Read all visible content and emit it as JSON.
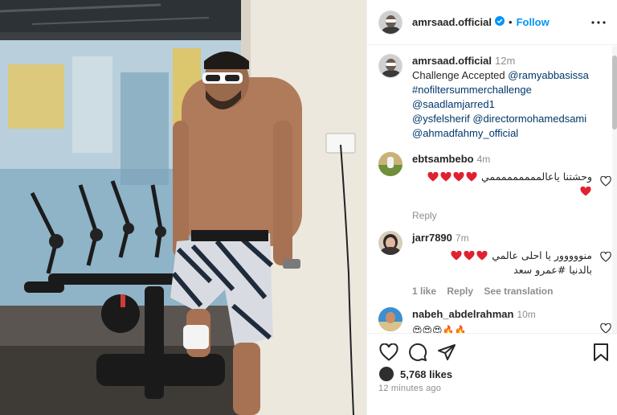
{
  "post": {
    "username": "amrsaad.official",
    "follow_label": "Follow",
    "caption": {
      "username": "amrsaad.official",
      "time": "12m",
      "intro": "Challenge Accepted",
      "first_mention": "@ramyabbasissa",
      "mentions": [
        "#nofiltersummerchallenge",
        "@saadlamjarred1",
        "@ysfelsherif"
      ],
      "inline_mention": "@directormohamedsami",
      "last_mention": "@ahmadfahmy_official"
    },
    "comments": [
      {
        "username": "ebtsambebo",
        "time": "4m",
        "text": "وحشتنا ياعالمممممممممي",
        "hearts": 5,
        "actions": [
          "Reply"
        ]
      },
      {
        "username": "jarr7890",
        "time": "7m",
        "text_line1": "منووووور يا احلى عالمي",
        "text_line2": "بالدنيا #عمرو سعد",
        "hearts": 3,
        "actions": [
          "1 like",
          "Reply",
          "See translation"
        ]
      },
      {
        "username": "nabeh_abdelrahman",
        "time": "10m",
        "emoji": "😍😍😍🔥🔥"
      }
    ],
    "likes": "5,768 likes",
    "posted_ago": "12 minutes ago"
  },
  "icons": [
    "verified-badge-icon",
    "more-options-icon",
    "heart-icon",
    "comment-icon",
    "share-icon",
    "save-icon"
  ],
  "colors": {
    "follow_blue": "#0095f6",
    "mention_blue": "#00376b",
    "muted_gray": "#8e8e8e",
    "heart_red": "#ed4956"
  }
}
